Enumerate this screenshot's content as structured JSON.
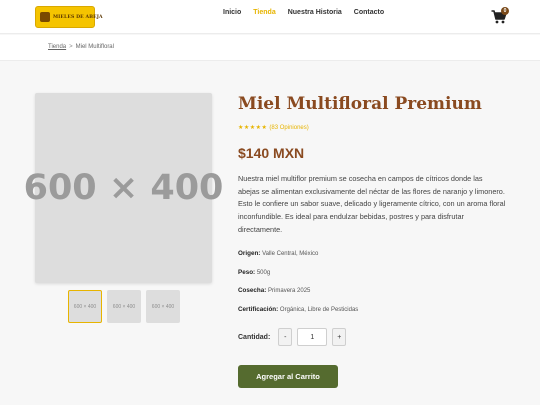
{
  "header": {
    "logo_text": "MIELES DE ABEJA",
    "nav": [
      "Inicio",
      "Tienda",
      "Nuestra Historia",
      "Contacto"
    ],
    "active_nav": "Tienda",
    "cart_count": "0"
  },
  "breadcrumb": {
    "parent": "Tienda",
    "separator": ">",
    "current": "Miel Multifloral"
  },
  "gallery": {
    "main_placeholder": "600 × 400",
    "thumbnails": [
      "600 × 400",
      "600 × 400",
      "600 × 400"
    ],
    "selected_thumbnail": 0
  },
  "product": {
    "title": "Miel Multifloral Premium",
    "stars": "★★★★★",
    "reviews": "(83 Opiniones)",
    "price": "$140 MXN",
    "description": "Nuestra miel multiflor premium se cosecha en campos de cítricos donde las abejas se alimentan exclusivamente del néctar de las flores de naranjo y limonero. Esto le confiere un sabor suave, delicado y ligeramente cítrico, con un aroma floral inconfundible. Es ideal para endulzar bebidas, postres y para disfrutar directamente.",
    "specs": [
      {
        "label": "Origen:",
        "value": "Valle Central, México"
      },
      {
        "label": "Peso:",
        "value": "500g"
      },
      {
        "label": "Cosecha:",
        "value": "Primavera 2025"
      },
      {
        "label": "Certificación:",
        "value": "Orgánica, Libre de Pesticidas"
      }
    ]
  },
  "quantity": {
    "label": "Cantidad:",
    "minus": "-",
    "value": "1",
    "plus": "+"
  },
  "add_to_cart": "Agregar al Carrito",
  "colors": {
    "accent_yellow": "#e7b400",
    "brand_brown": "#8a4a20",
    "button_green": "#556b2f"
  }
}
